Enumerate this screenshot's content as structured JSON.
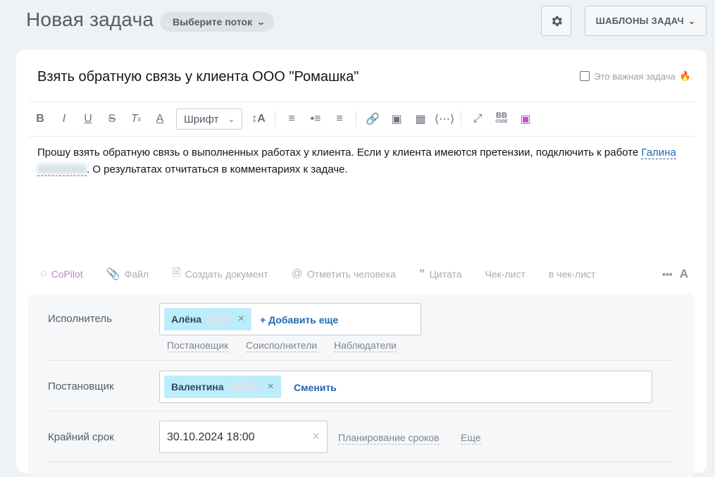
{
  "header": {
    "title": "Новая задача",
    "flow_select": "Выберите поток",
    "templates_button": "ШАБЛОНЫ ЗАДАЧ"
  },
  "task": {
    "title": "Взять обратную связь у клиента ООО \"Ромашка\"",
    "important_label": "Это важная задача",
    "body_part1": "Прошу взять обратную связь о выполненных работах у клиента. Если у клиента имеются претензии, подключить к работе",
    "mention_name": "Галина",
    "body_part2": ". О результатах отчитаться в комментариях к задаче."
  },
  "editor_toolbar": {
    "font_select": "Шрифт",
    "buttons": [
      "bold",
      "italic",
      "underline",
      "strikethrough",
      "clear-format",
      "font-color",
      "font-size",
      "numbered-list",
      "bulleted-list",
      "align",
      "link",
      "image",
      "table",
      "code",
      "fullscreen",
      "bbcode",
      "ai-image"
    ]
  },
  "actions": {
    "copilot": "CoPilot",
    "file": "Файл",
    "create_doc": "Создать документ",
    "mention": "Отметить человека",
    "quote": "Цитата",
    "checklist": "Чек-лист",
    "to_checklist": "в чек-лист"
  },
  "fields": {
    "assignee": {
      "label": "Исполнитель",
      "chip": "Алёна",
      "add_more": "Добавить еще",
      "roles": [
        "Постановщик",
        "Соисполнители",
        "Наблюдатели"
      ]
    },
    "creator": {
      "label": "Постановщик",
      "chip": "Валентина",
      "change": "Сменить"
    },
    "deadline": {
      "label": "Крайний срок",
      "value": "30.10.2024 18:00",
      "planning": "Планирование сроков",
      "more": "Еще"
    }
  },
  "colors": {
    "accent_link": "#2067b0",
    "chip_bg": "#bcedfc",
    "copilot": "#b884dc",
    "page_bg": "#eef2f4"
  }
}
